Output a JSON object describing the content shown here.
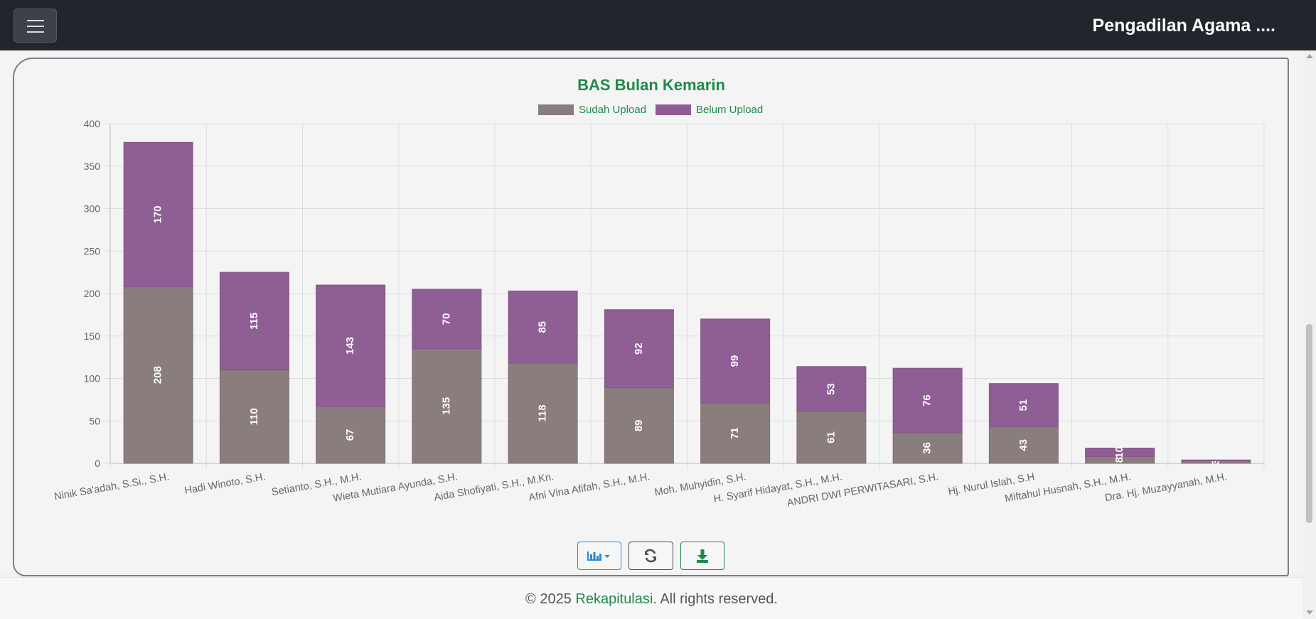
{
  "app": {
    "title": "Pengadilan Agama ...."
  },
  "toolbar": {
    "menu_icon": "hamburger-icon",
    "chart_type_icon": "bar-chart-icon",
    "refresh_icon": "refresh-icon",
    "download_icon": "download-icon"
  },
  "footer": {
    "prefix": "© 2025 ",
    "brand": "Rekapitulasi",
    "suffix": ". All rights reserved."
  },
  "colors": {
    "title": "#1e8a4c",
    "sudah": "#8a7d7d",
    "belum": "#8f5e95"
  },
  "chart_data": {
    "type": "bar",
    "stacked": true,
    "title": "BAS Bulan Kemarin",
    "legend_position": "top",
    "grid": true,
    "ylim": [
      0,
      400
    ],
    "yticks": [
      0,
      50,
      100,
      150,
      200,
      250,
      300,
      350,
      400
    ],
    "categories": [
      "Ninik Sa'adah, S.Si., S.H.",
      "Hadi Winoto, S.H.",
      "Setianto, S.H., M.H.",
      "Wieta Mutiara Ayunda, S.H.",
      "Aida Shofiyati, S.H., M.Kn.",
      "Afni Vina Afifah, S.H., M.H.",
      "Moh. Muhyidin, S.H.",
      "H. Syarif Hidayat, S.H., M.H.",
      "ANDRI DWI PERWITASARI, S.H.",
      "Hj. Nurul Islah, S.H",
      "Miftahul Husnah, S.H., M.H.",
      "Dra. Hj. Muzayyanah, M.H."
    ],
    "series": [
      {
        "name": "Sudah Upload",
        "values": [
          208,
          110,
          67,
          135,
          118,
          89,
          71,
          61,
          36,
          43,
          8,
          3
        ]
      },
      {
        "name": "Belum Upload",
        "values": [
          170,
          115,
          143,
          70,
          85,
          92,
          99,
          53,
          76,
          51,
          10,
          1
        ]
      }
    ],
    "value_labels": [
      [
        "208",
        "110",
        "67",
        "135",
        "118",
        "89",
        "71",
        "61",
        "36",
        "43",
        "8",
        "3"
      ],
      [
        "170",
        "115",
        "143",
        "70",
        "85",
        "92",
        "99",
        "53",
        "76",
        "51",
        "10",
        ""
      ]
    ]
  }
}
